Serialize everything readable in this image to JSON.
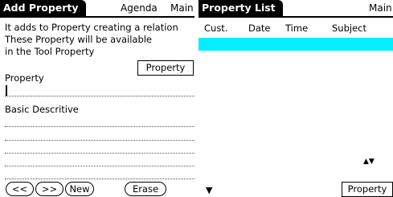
{
  "add_property": {
    "title": "Add Property",
    "menu_agenda": "Agenda",
    "menu_main": "Main",
    "intro_line1": "It adds to Property creating a relation",
    "intro_line2": "These Property will be available",
    "intro_line3": "in the Tool Property",
    "property_button": "Property",
    "property_label": "Property",
    "description_label": "Basic Descritive",
    "buttons": {
      "prev": "<<",
      "next": ">>",
      "new": "New",
      "erase": "Erase"
    }
  },
  "property_list": {
    "title": "Property List",
    "menu_main": "Main",
    "columns": [
      "Cust.",
      "Date",
      "Time",
      "Subject"
    ],
    "property_button": "Property"
  },
  "icons": [
    "cursor-icon",
    "scroll-arrows-icon",
    "dropdown-arrow-icon"
  ],
  "colors": {
    "title_bg": "#000000",
    "selection": "#00f0ff"
  }
}
